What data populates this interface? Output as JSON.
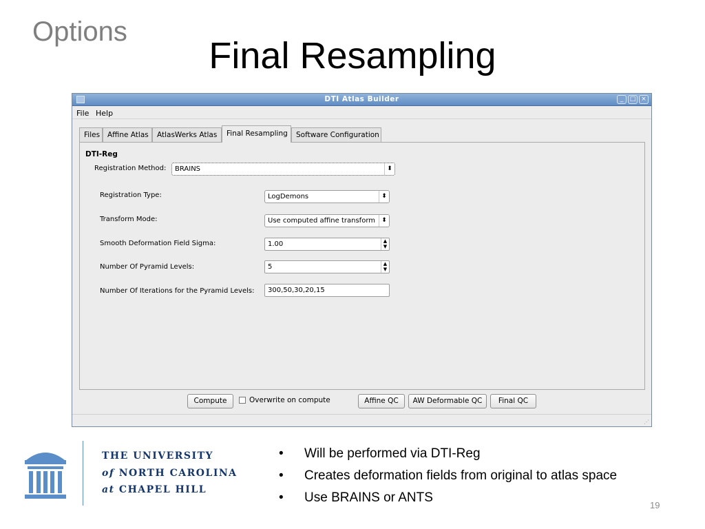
{
  "slide": {
    "section": "Options",
    "title": "Final Resampling",
    "page_number": "19",
    "bullets": [
      "Will be performed via DTI-Reg",
      "Creates deformation fields from original to atlas space",
      "Use BRAINS or ANTS"
    ],
    "bullet_glyph": "•"
  },
  "window": {
    "title": "DTI Atlas Builder",
    "menu": [
      "File",
      "Help"
    ],
    "tabs": [
      "Files",
      "Affine Atlas",
      "AtlasWerks Atlas",
      "Final Resampling",
      "Software Configuration"
    ],
    "active_tab": "Final Resampling",
    "section_heading": "DTI-Reg",
    "registration_method": {
      "label": "Registration Method:",
      "value": "BRAINS"
    },
    "fields": {
      "registration_type": {
        "label": "Registration Type:",
        "value": "LogDemons"
      },
      "transform_mode": {
        "label": "Transform Mode:",
        "value": "Use computed affine transform"
      },
      "smooth_sigma": {
        "label": "Smooth Deformation Field Sigma:",
        "value": "1.00"
      },
      "pyramid_levels": {
        "label": "Number Of Pyramid Levels:",
        "value": "5"
      },
      "iterations": {
        "label": "Number Of Iterations for the Pyramid Levels:",
        "value": "300,50,30,20,15"
      }
    },
    "buttons": {
      "compute": "Compute",
      "overwrite": "Overwrite on compute",
      "affine_qc": "Affine QC",
      "aw_deformable_qc": "AW Deformable QC",
      "final_qc": "Final QC"
    },
    "glyphs": {
      "combo_arrow": "⬍",
      "spin_up": "▲",
      "spin_down": "▼",
      "minimize": "_",
      "maximize": "□",
      "close": "×"
    }
  },
  "footer": {
    "university_line1": "THE UNIVERSITY",
    "university_line2_a": "of",
    "university_line2_b": "NORTH CAROLINA",
    "university_line3_a": "at",
    "university_line3_b": "CHAPEL HILL"
  },
  "colors": {
    "brand_blue": "#15366b",
    "unc_light_blue": "#5b8dc9",
    "titlebar": "#6f98cc"
  }
}
